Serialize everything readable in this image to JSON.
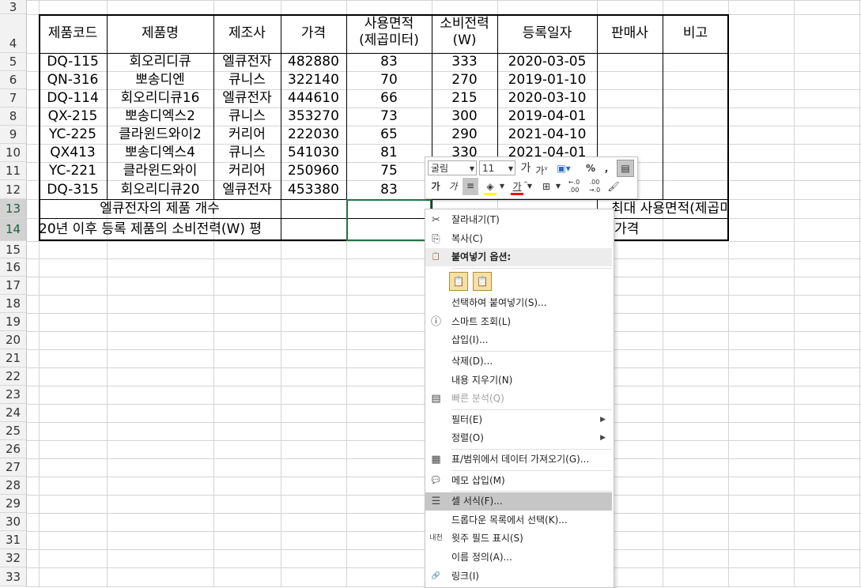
{
  "row_headers": [
    "3",
    "4",
    "5",
    "6",
    "7",
    "8",
    "9",
    "10",
    "11",
    "12",
    "13",
    "14",
    "15",
    "16",
    "17",
    "18",
    "19",
    "20",
    "21",
    "22",
    "23",
    "24",
    "25",
    "26",
    "27",
    "28",
    "29",
    "30",
    "31",
    "32",
    "33"
  ],
  "table": {
    "headers": [
      "제품코드",
      "제품명",
      "제조사",
      "가격",
      "사용면적\n(제곱미터)",
      "소비전력\n(W)",
      "등록일자",
      "판매사",
      "비고"
    ],
    "rows": [
      [
        "DQ-115",
        "회오리디큐",
        "엘큐전자",
        "482880",
        "83",
        "333",
        "2020-03-05",
        "",
        ""
      ],
      [
        "QN-316",
        "뽀송디엔",
        "큐니스",
        "322140",
        "70",
        "270",
        "2019-01-10",
        "",
        ""
      ],
      [
        "DQ-114",
        "회오리디큐16",
        "엘큐전자",
        "444610",
        "66",
        "215",
        "2020-03-10",
        "",
        ""
      ],
      [
        "QX-215",
        "뽀송디엑스2",
        "큐니스",
        "353270",
        "73",
        "300",
        "2019-04-01",
        "",
        ""
      ],
      [
        "YC-225",
        "클라윈드와이2",
        "커리어",
        "222030",
        "65",
        "290",
        "2021-04-10",
        "",
        ""
      ],
      [
        "QX413",
        "뽀송디엑스4",
        "큐니스",
        "541030",
        "81",
        "330",
        "2021-04-01",
        "",
        ""
      ],
      [
        "YC-221",
        "클라윈드와이",
        "커리어",
        "250960",
        "75",
        "",
        "",
        "",
        ""
      ],
      [
        "DQ-315",
        "회오리디큐20",
        "엘큐전자",
        "453380",
        "83",
        "",
        "",
        "",
        ""
      ]
    ],
    "summary1_label": "엘큐전자의 제품 개수",
    "summary2_label": "20년 이후 등록 제품의 소비전력(W) 평",
    "summary1_right": "최대 사용면적(제곱미터)",
    "summary2_right": "가격"
  },
  "mini_toolbar": {
    "font_name": "굴림",
    "font_size": "11",
    "grow_font": "가",
    "shrink_font": "가",
    "percent": "%",
    "comma": ",",
    "bold": "가",
    "italic": "가",
    "font_color_label": "가",
    "inc_decimal": "←.0 .00",
    "dec_decimal": ".00 →.0"
  },
  "context_menu": [
    {
      "label": "잘라내기(T)",
      "icon": "cut-icon",
      "glyph": "✂",
      "disabled": false
    },
    {
      "label": "복사(C)",
      "icon": "copy-icon",
      "glyph": "⎘",
      "disabled": false
    },
    {
      "label": "붙여넣기 옵션:",
      "icon": "paste-icon",
      "glyph": "📋",
      "section": true
    },
    {
      "label": "",
      "paste_icons": true
    },
    {
      "label": "선택하여 붙여넣기(S)...",
      "icon": "",
      "glyph": "",
      "disabled": false
    },
    {
      "label": "스마트 조회(L)",
      "icon": "smart-lookup-icon",
      "glyph": "ⓘ",
      "disabled": false
    },
    {
      "label": "삽입(I)...",
      "icon": "",
      "glyph": "",
      "disabled": false
    },
    {
      "label": "삭제(D)...",
      "icon": "",
      "glyph": "",
      "disabled": false
    },
    {
      "label": "내용 지우기(N)",
      "icon": "",
      "glyph": "",
      "disabled": false
    },
    {
      "label": "빠른 분석(Q)",
      "icon": "quick-analysis-icon",
      "glyph": "▤",
      "disabled": true
    },
    {
      "label": "필터(E)",
      "icon": "",
      "glyph": "",
      "disabled": false,
      "submenu": true
    },
    {
      "label": "정렬(O)",
      "icon": "",
      "glyph": "",
      "disabled": false,
      "submenu": true
    },
    {
      "label": "표/범위에서 데이터 가져오기(G)...",
      "icon": "table-icon",
      "glyph": "▦",
      "disabled": false
    },
    {
      "label": "메모 삽입(M)",
      "icon": "comment-icon",
      "glyph": "💬",
      "disabled": false
    },
    {
      "label": "셀 서식(F)...",
      "icon": "format-cells-icon",
      "glyph": "☰",
      "disabled": false,
      "highlight": true
    },
    {
      "label": "드롭다운 목록에서 선택(K)...",
      "icon": "",
      "glyph": "",
      "disabled": false
    },
    {
      "label": "윗주 필드 표시(S)",
      "icon": "phonetic-icon",
      "glyph": "내천",
      "disabled": false
    },
    {
      "label": "이름 정의(A)...",
      "icon": "",
      "glyph": "",
      "disabled": false
    },
    {
      "label": "링크(I)",
      "icon": "link-icon",
      "glyph": "🔗",
      "disabled": false
    }
  ],
  "colors": {
    "selection": "#217346",
    "menu_highlight": "#c6c6c6",
    "font_color_bar": "#ff0000",
    "fill_color_bar": "#ffff00"
  }
}
